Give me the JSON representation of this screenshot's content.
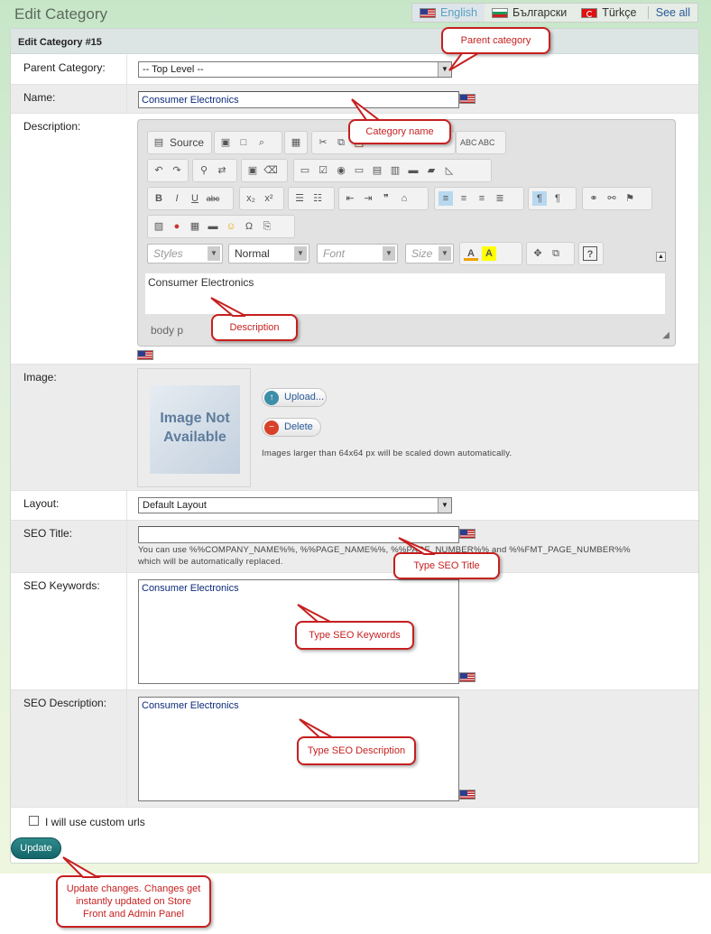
{
  "title": "Edit Category",
  "languages": [
    {
      "label": "English"
    },
    {
      "label": "Български"
    },
    {
      "label": "Türkçe"
    }
  ],
  "see_all": "See all",
  "panel_title": "Edit Category #15",
  "fields": {
    "parent_label": "Parent Category:",
    "parent_value": "-- Top Level --",
    "name_label": "Name:",
    "name_value": "Consumer Electronics",
    "desc_label": "Description:",
    "desc_value": "Consumer Electronics",
    "image_label": "Image:",
    "image_placeholder": "Image Not Available",
    "upload": "Upload...",
    "delete": "Delete",
    "image_hint": "Images larger than 64x64 px will be scaled down automatically.",
    "layout_label": "Layout:",
    "layout_value": "Default Layout",
    "seo_title_label": "SEO Title:",
    "seo_hint_1": "You can use %%COMPANY_NAME%%, %%PAGE_NAME%%, %%PAGE_NUMBER%% and %%FMT_PAGE_NUMBER%%",
    "seo_hint_2": "which will be automatically replaced.",
    "seo_kw_label": "SEO Keywords:",
    "seo_kw_value": "Consumer Electronics",
    "seo_desc_label": "SEO Description:",
    "seo_desc_value": "Consumer Electronics",
    "custom_urls": "I will use custom urls",
    "update": "Update"
  },
  "editor": {
    "source": "Source",
    "styles": "Styles",
    "format": "Normal",
    "font": "Font",
    "size": "Size",
    "path": "body  p"
  },
  "callouts": {
    "parent": "Parent category",
    "name": "Category name",
    "desc": "Description",
    "seo_title": "Type SEO Title",
    "seo_kw": "Type SEO Keywords",
    "seo_desc": "Type SEO Description",
    "update": "Update changes. Changes get instantly updated on Store Front and Admin Panel"
  }
}
